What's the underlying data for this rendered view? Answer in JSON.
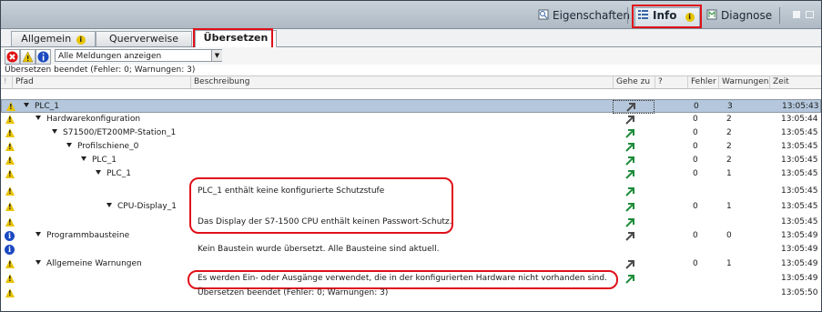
{
  "header": {
    "eigenschaften": "Eigenschaften",
    "info": "Info",
    "diagnose": "Diagnose"
  },
  "tabs": {
    "allgemein": "Allgemein",
    "querverweise": "Querverweise",
    "uebersetzen": "Übersetzen"
  },
  "filter": {
    "selected": "Alle Meldungen anzeigen"
  },
  "status_line": "Übersetzen beendet (Fehler: 0; Warnungen: 3)",
  "columns": {
    "pfad": "Pfad",
    "beschreibung": "Beschreibung",
    "gehezu": "Gehe zu",
    "q": "?",
    "fehler": "Fehler",
    "warnungen": "Warnungen",
    "zeit": "Zeit"
  },
  "rows": [
    {
      "pfad": "PLC_1",
      "desc": "",
      "fehler": "0",
      "warn": "3",
      "zeit": "13:05:43"
    },
    {
      "pfad": "Hardwarekonfiguration",
      "desc": "",
      "fehler": "0",
      "warn": "2",
      "zeit": "13:05:44"
    },
    {
      "pfad": "S71500/ET200MP-Station_1",
      "desc": "",
      "fehler": "0",
      "warn": "2",
      "zeit": "13:05:45"
    },
    {
      "pfad": "Profilschiene_0",
      "desc": "",
      "fehler": "0",
      "warn": "2",
      "zeit": "13:05:45"
    },
    {
      "pfad": "PLC_1",
      "desc": "",
      "fehler": "0",
      "warn": "2",
      "zeit": "13:05:45"
    },
    {
      "pfad": "PLC_1",
      "desc": "",
      "fehler": "0",
      "warn": "1",
      "zeit": "13:05:45"
    },
    {
      "pfad": "",
      "desc": "PLC_1 enthält keine konfigurierte Schutzstufe",
      "fehler": "",
      "warn": "",
      "zeit": "13:05:45"
    },
    {
      "pfad": "CPU-Display_1",
      "desc": "",
      "fehler": "0",
      "warn": "1",
      "zeit": "13:05:45"
    },
    {
      "pfad": "",
      "desc": "Das Display der S7-1500 CPU enthält keinen Passwort-Schutz.",
      "fehler": "",
      "warn": "",
      "zeit": "13:05:45"
    },
    {
      "pfad": "Programmbausteine",
      "desc": "",
      "fehler": "0",
      "warn": "0",
      "zeit": "13:05:49"
    },
    {
      "pfad": "",
      "desc": "Kein Baustein wurde übersetzt. Alle Bausteine sind aktuell.",
      "fehler": "",
      "warn": "",
      "zeit": "13:05:49"
    },
    {
      "pfad": "Allgemeine Warnungen",
      "desc": "",
      "fehler": "0",
      "warn": "1",
      "zeit": "13:05:49"
    },
    {
      "pfad": "",
      "desc": "Es werden Ein- oder Ausgänge verwendet, die in der konfigurierten Hardware nicht vorhanden sind.",
      "fehler": "",
      "warn": "",
      "zeit": "13:05:49"
    },
    {
      "pfad": "",
      "desc": "Übersetzen beendet (Fehler: 0; Warnungen: 3)",
      "fehler": "",
      "warn": "",
      "zeit": "13:05:50"
    }
  ]
}
